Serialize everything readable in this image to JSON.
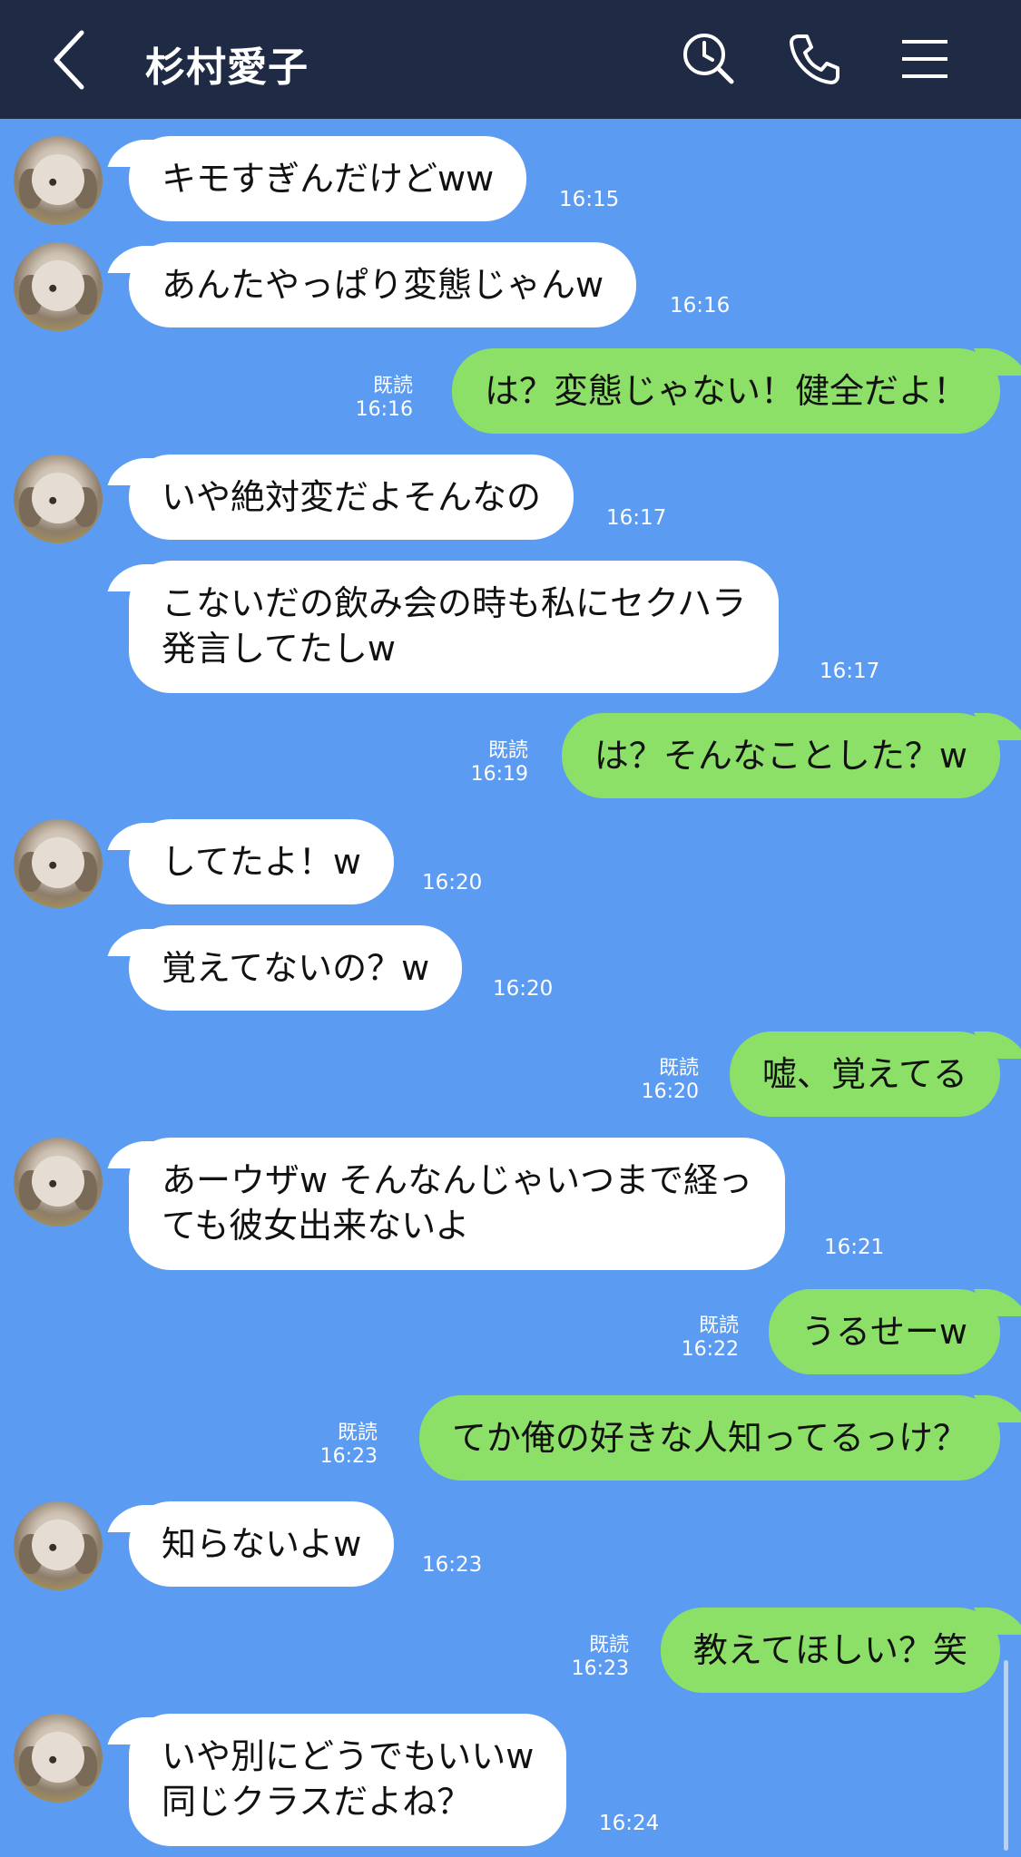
{
  "header": {
    "title": "杉村愛子"
  },
  "colors": {
    "header_bg": "#1f2a44",
    "chat_bg": "#5b9bf1",
    "incoming": "#ffffff",
    "outgoing": "#8ce067"
  },
  "icons": {
    "back": "chevron-left-icon",
    "search": "clock-search-icon",
    "call": "phone-icon",
    "menu": "hamburger-menu-icon"
  },
  "messages": [
    {
      "text": "キモすぎんだけどww",
      "time": "16:15"
    },
    {
      "text": "あんたやっぱり変態じゃんw",
      "time": "16:16"
    },
    {
      "text": "は？変態じゃない！健全だよ！",
      "read": "既読",
      "time": "16:16"
    },
    {
      "text": "いや絶対変だよそんなの",
      "time": "16:17"
    },
    {
      "line1": "こないだの飲み会の時も私にセクハラ",
      "line2": "発言してたしw",
      "time": "16:17"
    },
    {
      "text": "は？そんなことした？w",
      "read": "既読",
      "time": "16:19"
    },
    {
      "text": "してたよ！w",
      "time": "16:20"
    },
    {
      "text": "覚えてないの？w",
      "time": "16:20"
    },
    {
      "text": "嘘、覚えてる",
      "read": "既読",
      "time": "16:20"
    },
    {
      "line1": "あーウザw そんなんじゃいつまで経っ",
      "line2": "ても彼女出来ないよ",
      "time": "16:21"
    },
    {
      "text": "うるせーw",
      "read": "既読",
      "time": "16:22"
    },
    {
      "text": "てか俺の好きな人知ってるっけ？",
      "read": "既読",
      "time": "16:23"
    },
    {
      "text": "知らないよw",
      "time": "16:23"
    },
    {
      "text": "教えてほしい？笑",
      "read": "既読",
      "time": "16:23"
    },
    {
      "line1": "いや別にどうでもいいw",
      "line2": "同じクラスだよね？",
      "time": "16:24"
    }
  ]
}
